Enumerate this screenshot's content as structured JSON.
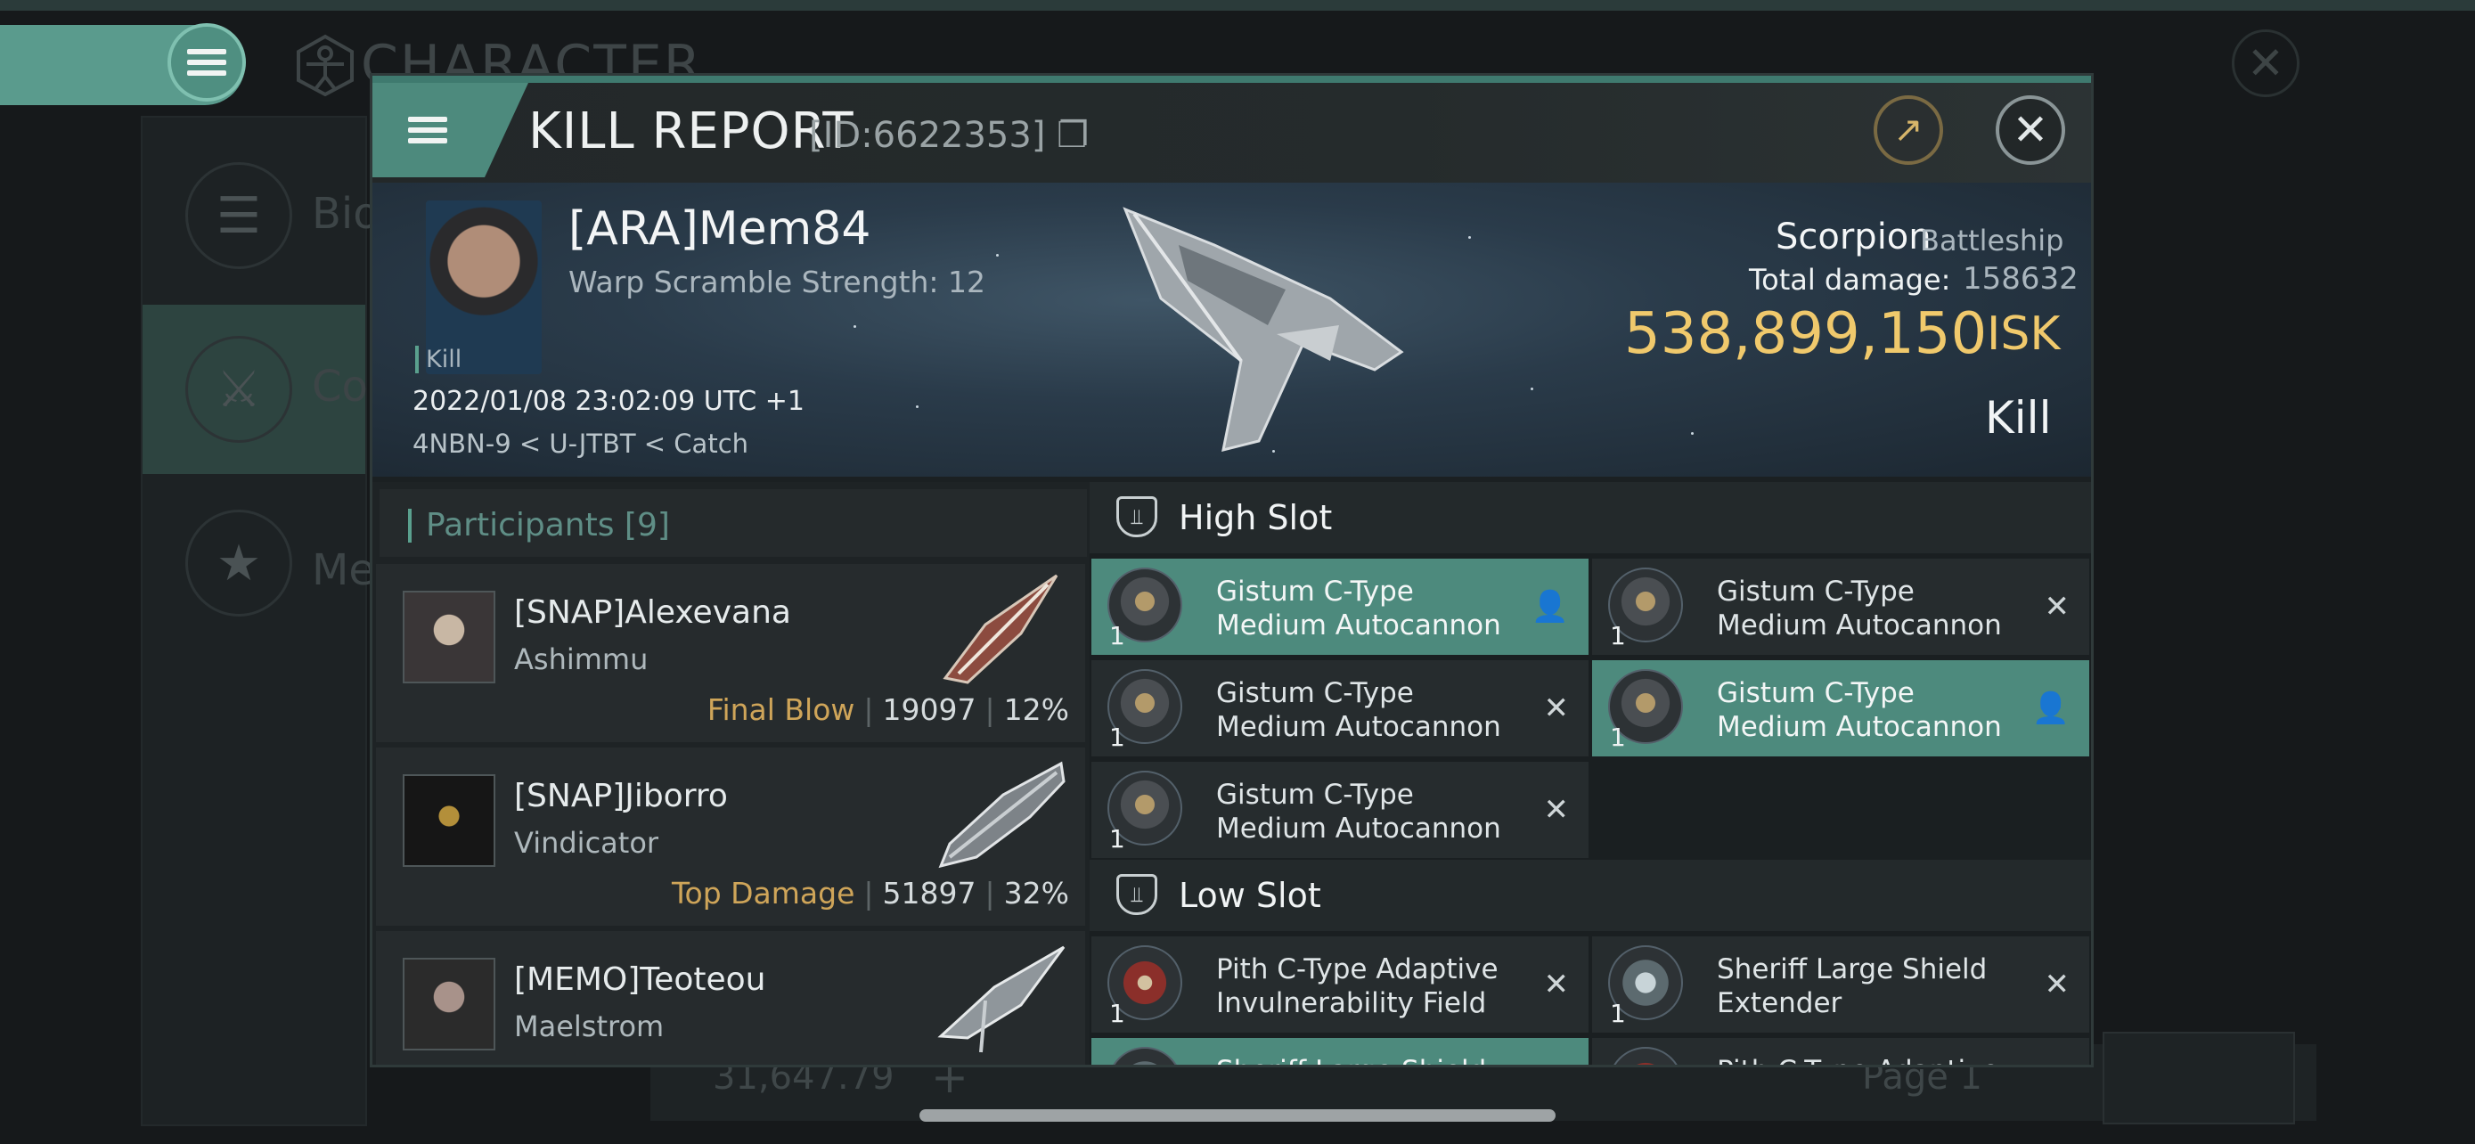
{
  "background": {
    "title": "CHARACTER",
    "sidebar": [
      {
        "label": "Bio",
        "icon": "list-icon"
      },
      {
        "label": "Co",
        "icon": "crossed-swords-icon"
      },
      {
        "label": "Me",
        "icon": "star-medal-icon"
      }
    ],
    "bottom_bar": {
      "isk": "31,647.79",
      "page": "Page 1"
    }
  },
  "dialog": {
    "title": "KILL REPORT",
    "id_label": "[ID:6622353]",
    "victim": {
      "name": "[ARA]Mem84",
      "warp_scramble": "Warp Scramble Strength: 12",
      "tag": "Kill",
      "datetime": "2022/01/08 23:02:09 UTC +1",
      "location": "4NBN-9 < U-JTBT < Catch"
    },
    "ship": {
      "name": "Scorpion",
      "class": "Battleship",
      "damage_label": "Total damage:",
      "damage_value": "158632",
      "isk_value": "538,899,150",
      "isk_unit": "ISK",
      "result": "Kill"
    },
    "participants": {
      "label": "Participants",
      "count": "[9]",
      "rows": [
        {
          "name": "[SNAP]Alexevana",
          "ship": "Ashimmu",
          "tag": "Final Blow",
          "damage": "19097",
          "percent": "12%"
        },
        {
          "name": "[SNAP]Jiborro",
          "ship": "Vindicator",
          "tag": "Top Damage",
          "damage": "51897",
          "percent": "32%"
        },
        {
          "name": "[MEMO]Teoteou",
          "ship": "Maelstrom"
        }
      ]
    },
    "high_slot": {
      "label": "High Slot",
      "modules": [
        {
          "line1": "Gistum C-Type",
          "line2": "Medium Autocannon",
          "qty": "1",
          "status": "pilot-icon",
          "active": true
        },
        {
          "line1": "Gistum C-Type",
          "line2": "Medium Autocannon",
          "qty": "1",
          "status": "x-icon",
          "active": false
        },
        {
          "line1": "Gistum C-Type",
          "line2": "Medium Autocannon",
          "qty": "1",
          "status": "x-icon",
          "active": false
        },
        {
          "line1": "Gistum C-Type",
          "line2": "Medium Autocannon",
          "qty": "1",
          "status": "pilot-icon",
          "active": true
        },
        {
          "line1": "Gistum C-Type",
          "line2": "Medium Autocannon",
          "qty": "1",
          "status": "x-icon",
          "active": false
        }
      ]
    },
    "low_slot": {
      "label": "Low Slot",
      "modules": [
        {
          "line1": "Pith C-Type Adaptive",
          "line2": "Invulnerability Field",
          "qty": "1",
          "status": "x-icon",
          "active": false
        },
        {
          "line1": "Sheriff Large Shield",
          "line2": "Extender",
          "qty": "1",
          "status": "x-icon",
          "active": false
        },
        {
          "line1": "Sheriff Large Shield",
          "line2": "",
          "qty": "",
          "status": "",
          "active": true
        },
        {
          "line1": "Pith C-Type Adaptive",
          "line2": "",
          "qty": "",
          "status": "",
          "active": false
        }
      ]
    }
  },
  "colors": {
    "accent": "#4d8a7d",
    "isk": "#f0c96c",
    "highlight": "#cfa559"
  }
}
